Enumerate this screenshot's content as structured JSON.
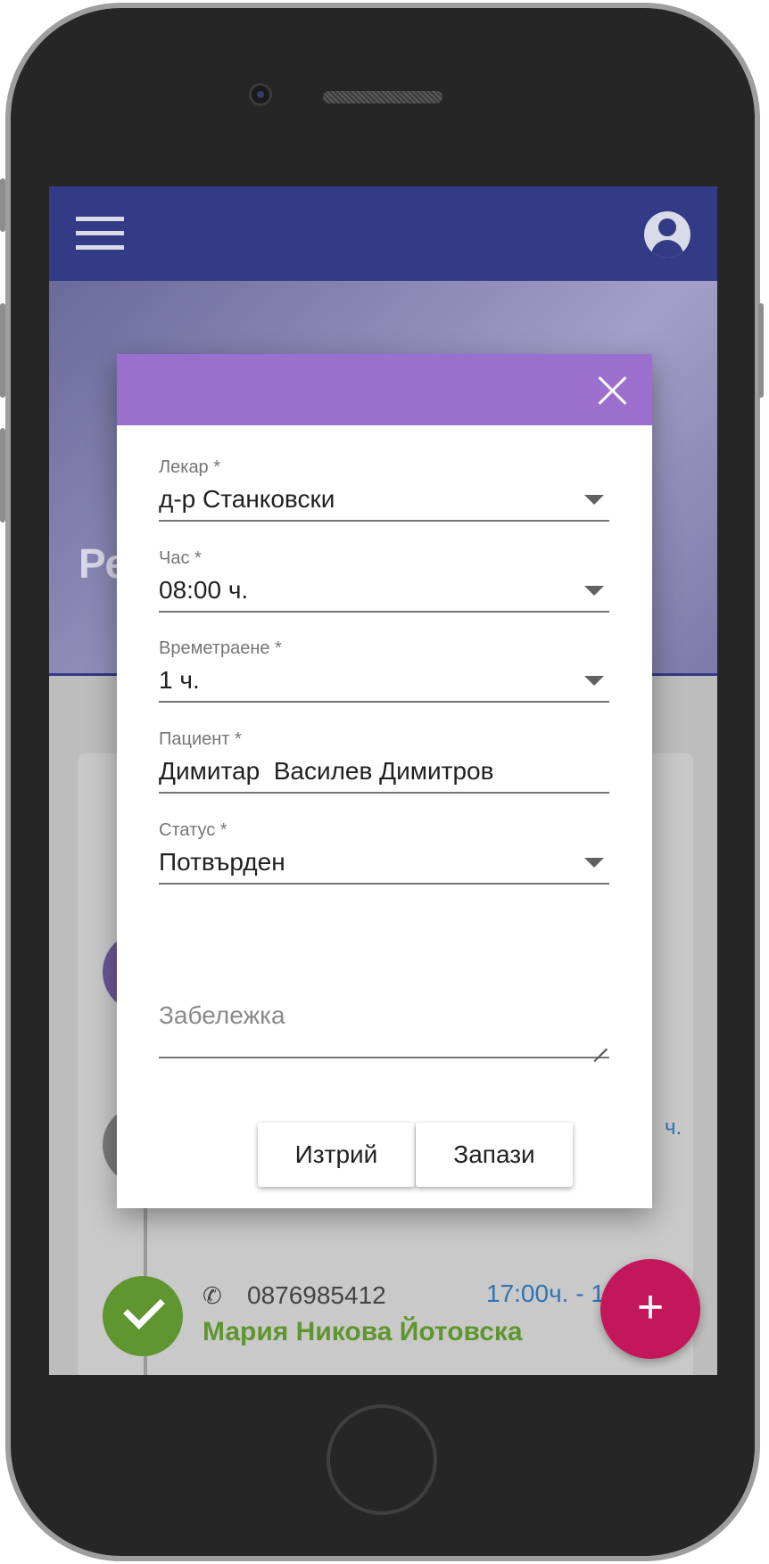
{
  "hero": {
    "title_fragment": "Ре"
  },
  "dialog": {
    "fields": [
      {
        "label": "Лекар *",
        "value": "д-р Станковски"
      },
      {
        "label": "Час *",
        "value": "08:00 ч."
      },
      {
        "label": "Времетраене *",
        "value": "1 ч."
      },
      {
        "label": "Пациент *",
        "value": "Димитар  Василев Димитров"
      },
      {
        "label": "Статус *",
        "value": "Потвърден"
      }
    ],
    "notes_placeholder": "Забележка",
    "delete_label": "Изтрий",
    "save_label": "Запази"
  },
  "background_list": {
    "time_fragment_1": "ч.",
    "time_fragment_2": "ч.",
    "entry": {
      "phone": "0876985412",
      "time": "17:00ч. - 18",
      "name": "Мария Никова Йотовска"
    }
  },
  "fab": {
    "label": "+"
  },
  "colors": {
    "appbar": "#333a86",
    "dialog_header": "#9b6fcd",
    "fab": "#c2185b",
    "confirmed_green": "#5f9630",
    "time_blue": "#2f74b4"
  },
  "icons": [
    "menu-icon",
    "account-icon",
    "close-icon",
    "dropdown-arrow-icon",
    "phone-icon",
    "check-icon",
    "resize-icon",
    "plus-icon"
  ]
}
